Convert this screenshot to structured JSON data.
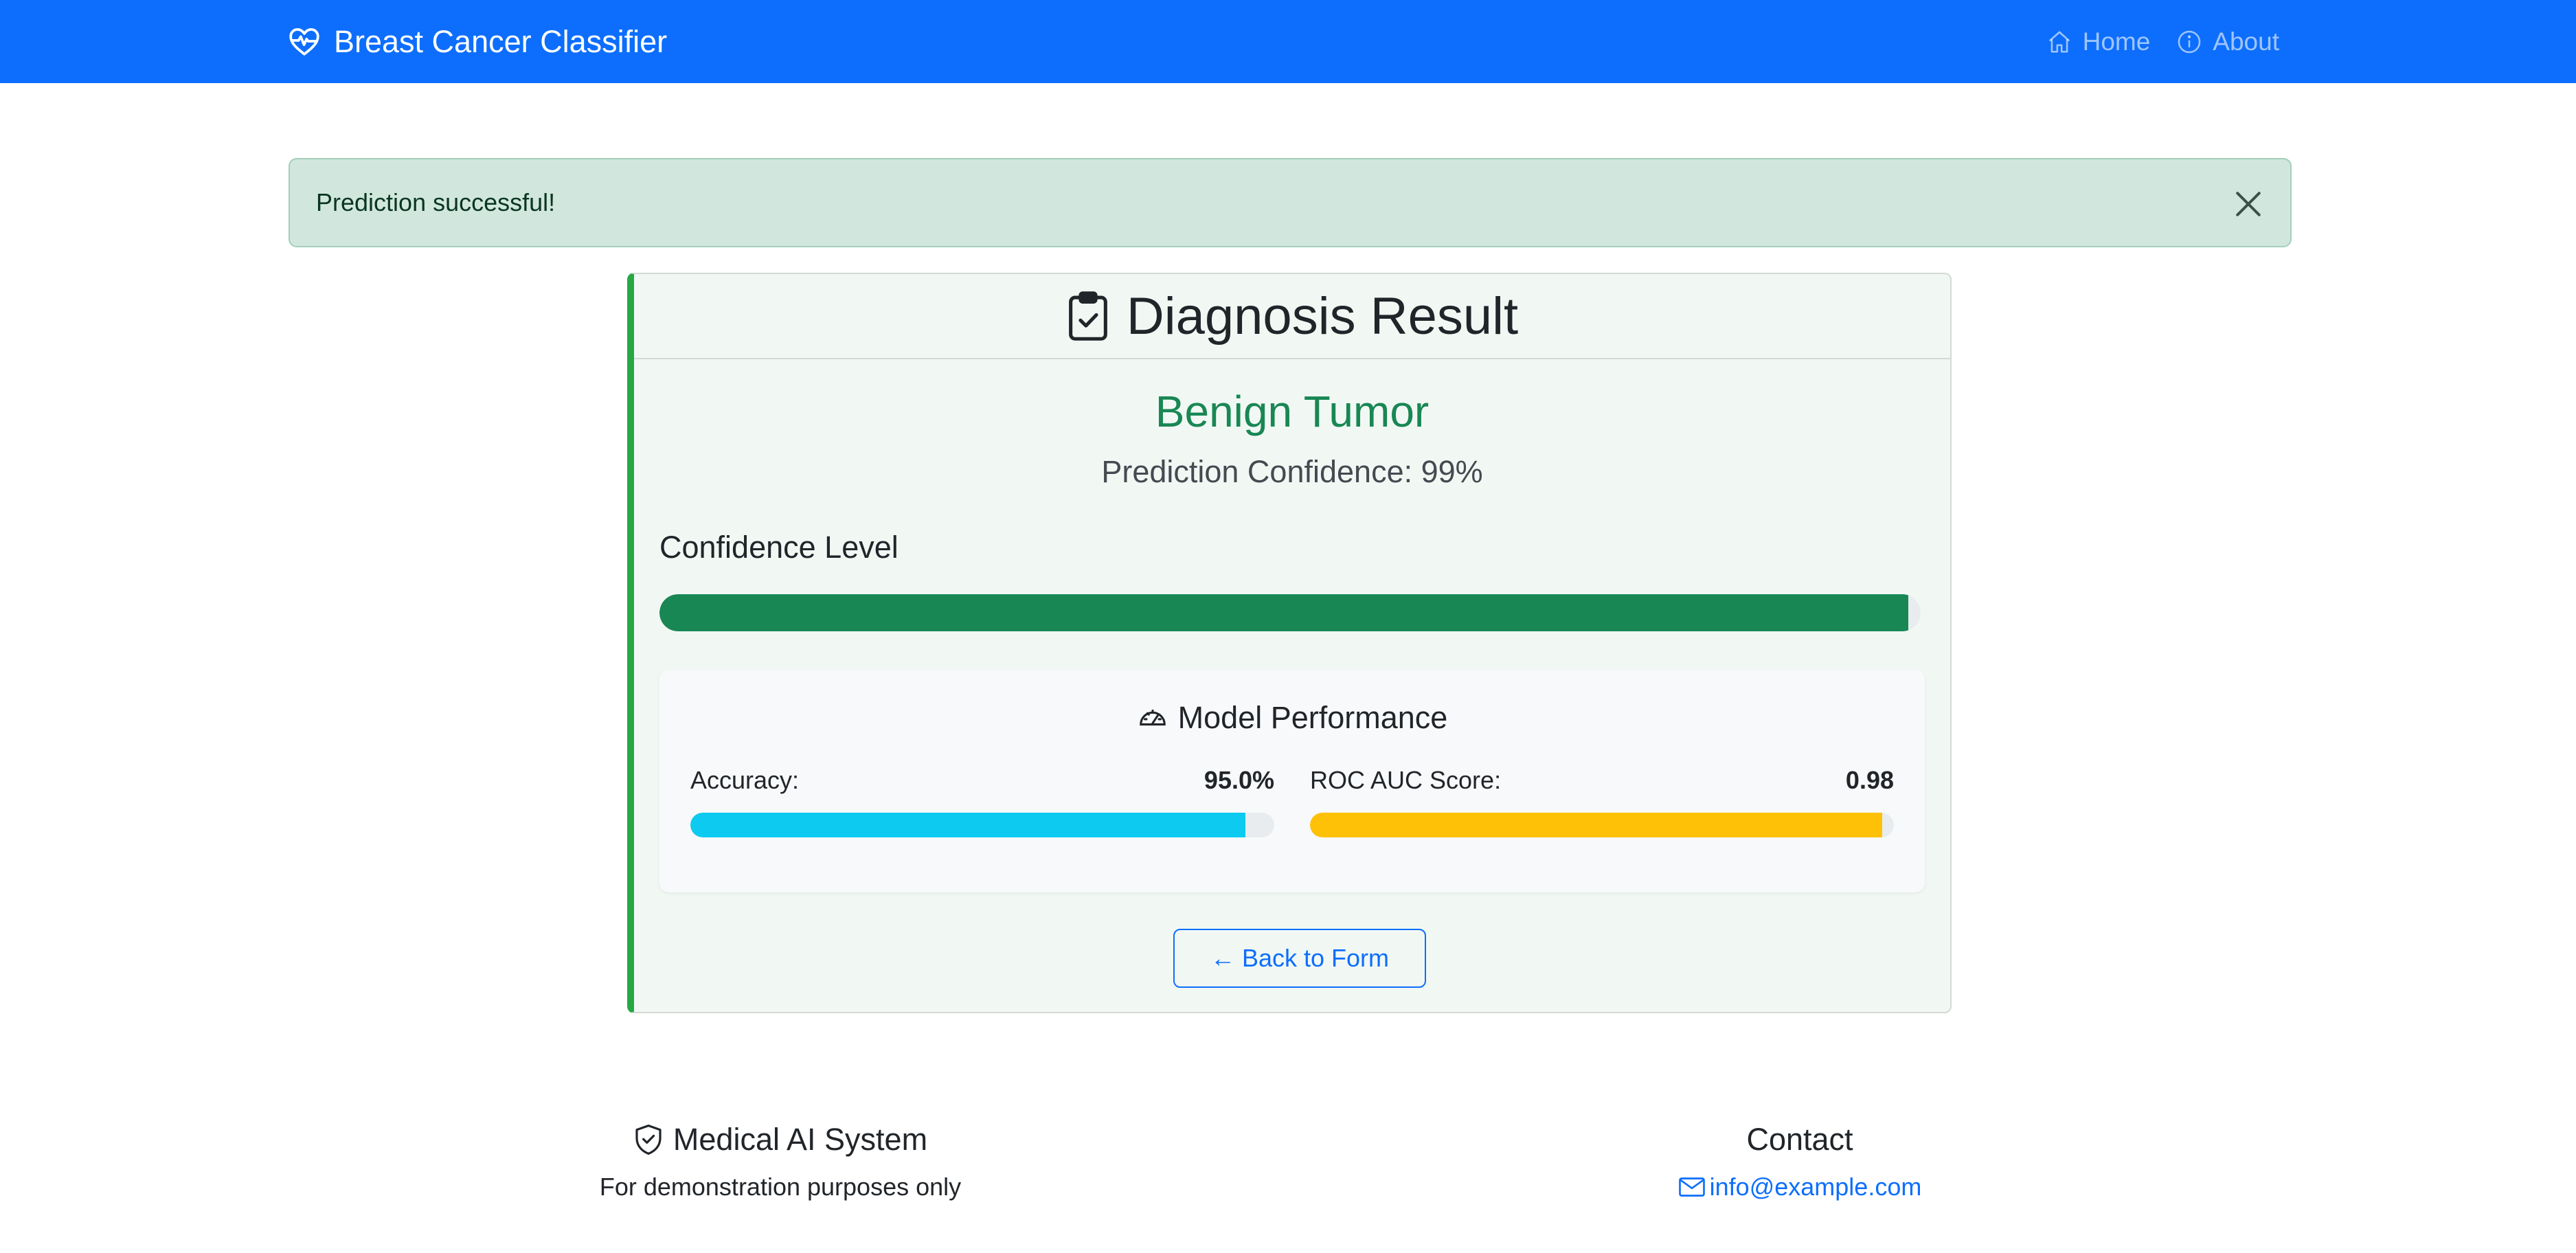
{
  "navbar": {
    "brand": "Breast Cancer Classifier",
    "links": [
      {
        "label": "Home",
        "icon": "house-icon"
      },
      {
        "label": "About",
        "icon": "info-circle-icon"
      }
    ],
    "background": "#0d6efd"
  },
  "alert": {
    "message": "Prediction successful!",
    "type": "success"
  },
  "result": {
    "header": "Diagnosis Result",
    "diagnosis": "Benign Tumor",
    "confidence_text": "Prediction Confidence: 99%",
    "confidence_label": "Confidence Level",
    "confidence_value": 99,
    "accent_color": "#198754"
  },
  "performance": {
    "title": "Model Performance",
    "metrics": [
      {
        "label": "Accuracy:",
        "value": "95.0%",
        "fraction": 0.95,
        "color": "#0dcaf0"
      },
      {
        "label": "ROC AUC Score:",
        "value": "0.98",
        "fraction": 0.98,
        "color": "#ffc107"
      }
    ]
  },
  "back_button": "← Back to Form",
  "footer": {
    "left_title": "Medical AI System",
    "left_text": "For demonstration purposes only",
    "right_title": "Contact",
    "email": "info@example.com"
  }
}
